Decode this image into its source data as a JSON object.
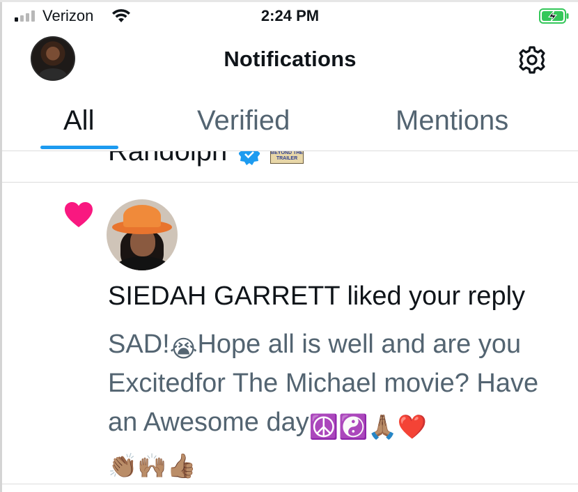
{
  "status_bar": {
    "carrier": "Verizon",
    "time": "2:24 PM",
    "signal_bars_filled": 1,
    "signal_bars_total": 4,
    "battery_state": "charging"
  },
  "header": {
    "title": "Notifications"
  },
  "tabs": [
    {
      "label": "All",
      "active": true
    },
    {
      "label": "Verified",
      "active": false
    },
    {
      "label": "Mentions",
      "active": false
    }
  ],
  "previous_item": {
    "name_fragment": "Randolph",
    "image_text": "BEYOND THE TRAILER"
  },
  "notification": {
    "type": "like",
    "headline": "SIEDAH GARRETT liked your reply",
    "body_parts": [
      "SAD!",
      "😭",
      "Hope all is well and are you Excitedfor The Michael movie? Have an Awesome day",
      "☮️",
      "☯️",
      "🙏🏽",
      "❤️",
      "👏🏽",
      "🙌🏽",
      "👍🏽"
    ]
  },
  "colors": {
    "accent": "#1d9bf0",
    "heart": "#f91880",
    "battery": "#34c759",
    "secondary_text": "#536471"
  },
  "icons": {
    "settings": "gear-icon",
    "like": "heart-icon",
    "verified": "verified-badge-icon",
    "wifi": "wifi-icon"
  }
}
